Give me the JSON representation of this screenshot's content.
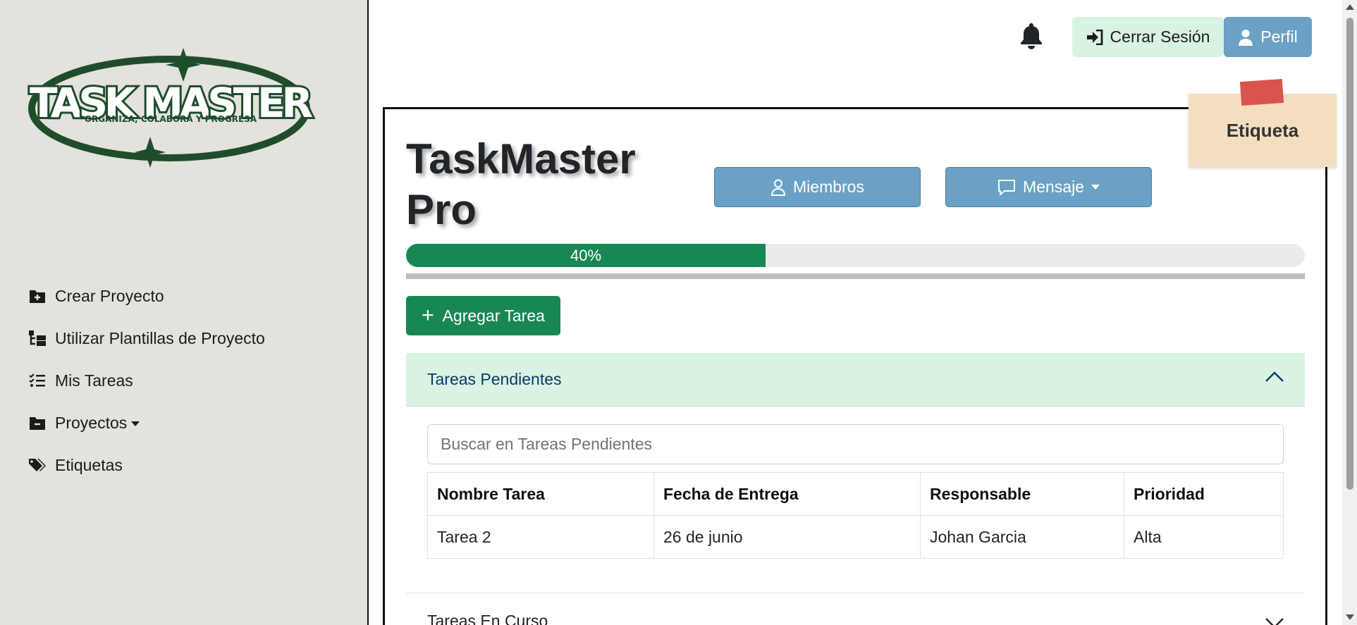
{
  "sidebar": {
    "logo": {
      "title": "TASK MASTER",
      "tagline": "ORGANIZA, COLABORA Y PROGRESA"
    },
    "items": [
      {
        "label": "Crear Proyecto",
        "icon": "folder-plus-icon"
      },
      {
        "label": "Utilizar Plantillas de Proyecto",
        "icon": "folder-tree-icon"
      },
      {
        "label": "Mis Tareas",
        "icon": "list-check-icon"
      },
      {
        "label": "Proyectos",
        "icon": "folder-minus-icon"
      },
      {
        "label": "Etiquetas",
        "icon": "tags-icon"
      }
    ]
  },
  "topbar": {
    "logout_label": "Cerrar Sesión",
    "profile_label": "Perfil"
  },
  "note": {
    "label": "Etiqueta"
  },
  "project": {
    "title_line1": "TaskMaster",
    "title_line2": "Pro",
    "members_label": "Miembros",
    "message_label": "Mensaje",
    "progress": 0.4,
    "progress_label": "40%",
    "add_task_label": "Agregar Tarea"
  },
  "pending": {
    "header": "Tareas Pendientes",
    "search_placeholder": "Buscar en Tareas Pendientes",
    "columns": [
      "Nombre Tarea",
      "Fecha de Entrega",
      "Responsable",
      "Prioridad"
    ],
    "rows": [
      [
        "Tarea 2",
        "26 de junio",
        "Johan Garcia",
        "Alta"
      ]
    ]
  },
  "in_progress": {
    "header": "Tareas En Curso"
  },
  "colors": {
    "sidebar_bg": "#e4e2dc",
    "logo_green": "#1f4d2c",
    "primary_blue": "#6aa1c4",
    "success_green": "#198754",
    "light_green": "#d9f3e3",
    "note_bg": "#f3dfc0",
    "note_tape": "#d9534f"
  }
}
